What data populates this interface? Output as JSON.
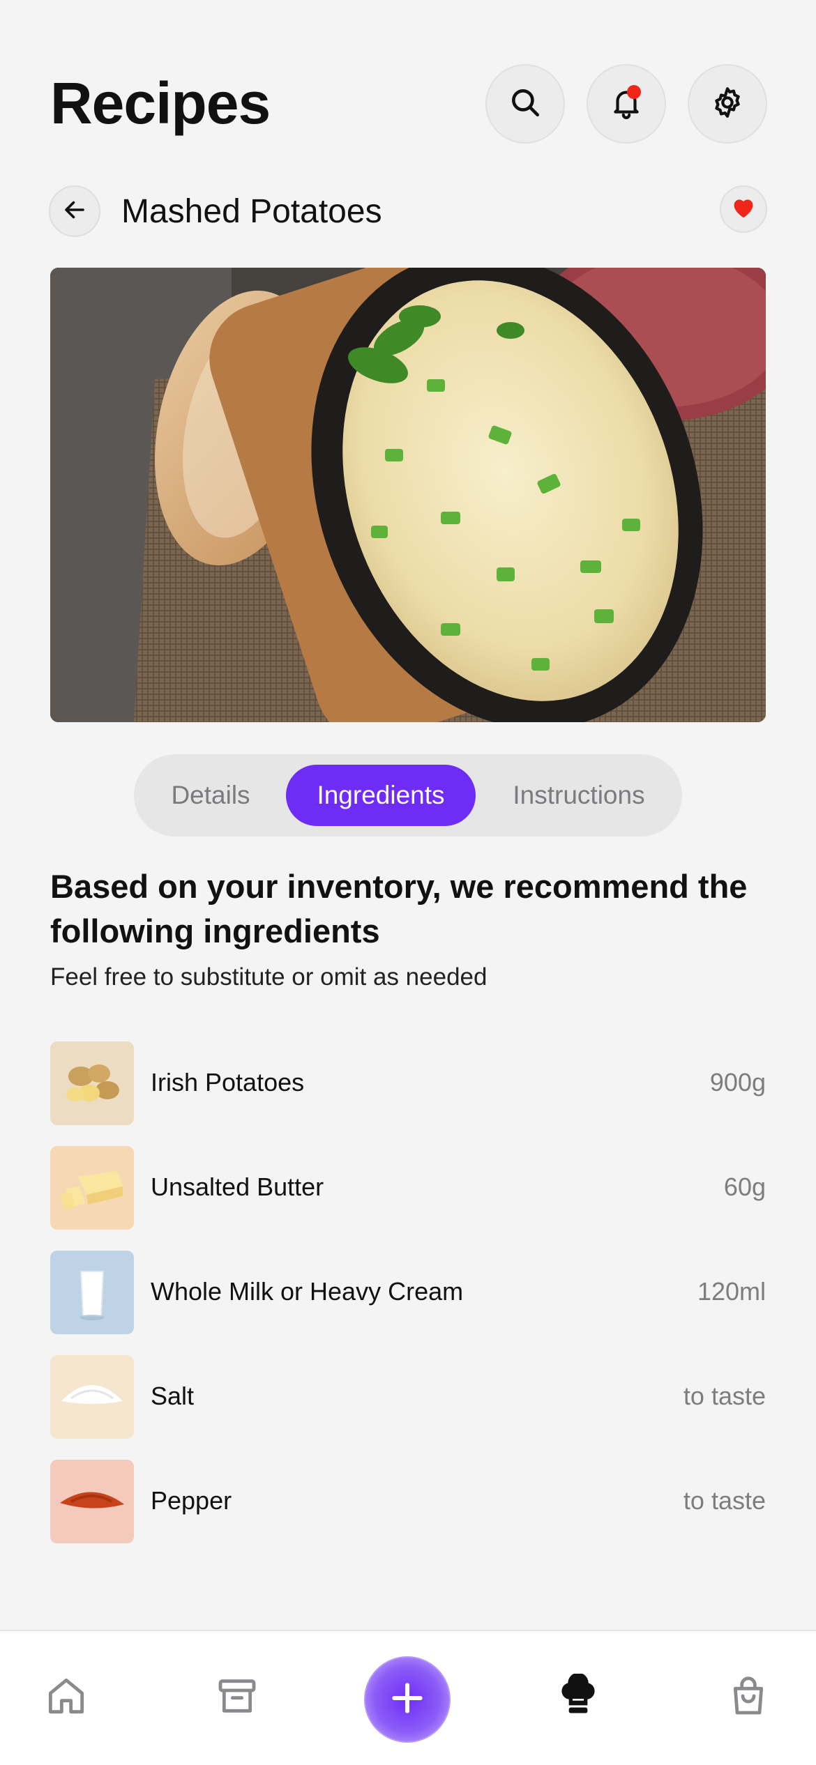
{
  "header": {
    "title": "Recipes",
    "icons": [
      "search-icon",
      "bell-icon",
      "gear-icon"
    ],
    "has_notification": true
  },
  "recipe": {
    "name": "Mashed Potatoes",
    "favorited": true
  },
  "tabs": [
    {
      "label": "Details",
      "active": false
    },
    {
      "label": "Ingredients",
      "active": true
    },
    {
      "label": "Instructions",
      "active": false
    }
  ],
  "recommendation": {
    "heading": "Based on your inventory, we recommend the following ingredients",
    "subtext": "Feel free to substitute or omit as needed"
  },
  "ingredients": [
    {
      "name": "Irish Potatoes",
      "quantity": "900g",
      "thumb_color": "#ebdcc2"
    },
    {
      "name": "Unsalted Butter",
      "quantity": "60g",
      "thumb_color": "#f7d8b5"
    },
    {
      "name": "Whole Milk or Heavy Cream",
      "quantity": "120ml",
      "thumb_color": "#bfd3e6"
    },
    {
      "name": "Salt",
      "quantity": "to taste",
      "thumb_color": "#f5e6cf"
    },
    {
      "name": "Pepper",
      "quantity": "to taste",
      "thumb_color": "#f3cabb"
    }
  ],
  "bottom_nav": {
    "items": [
      "home-icon",
      "archive-icon",
      "add-icon",
      "chef-hat-icon",
      "shopping-bag-icon"
    ],
    "active": "chef-hat-icon"
  },
  "colors": {
    "accent": "#6e2cf6",
    "background": "#f4f4f5",
    "notification": "#f0261b",
    "favorite": "#f0261b"
  }
}
